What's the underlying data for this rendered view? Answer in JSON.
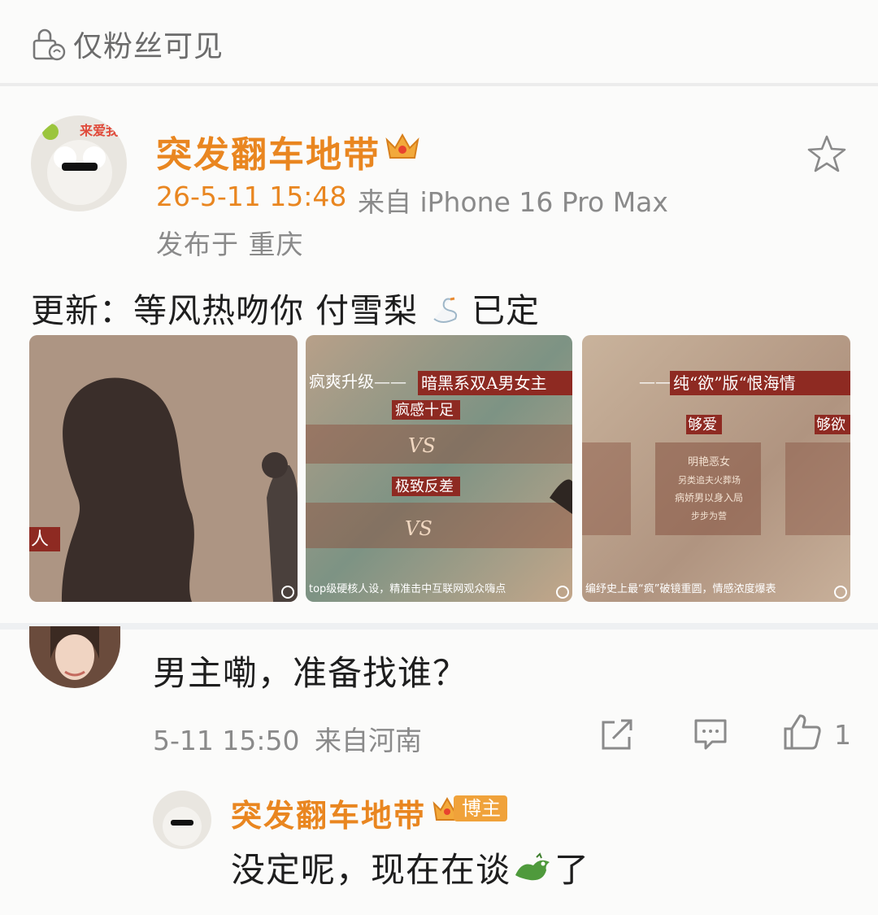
{
  "header": {
    "visibility_label": "仅粉丝可见"
  },
  "post": {
    "username": "突发翻车地带",
    "timestamp": "26-5-11 15:48",
    "source": "来自 iPhone 16 Pro Max",
    "location": "发布于 重庆",
    "content_before": "更新：等风热吻你 付雪梨",
    "content_after": "已定",
    "images": [
      {
        "caption_left": "人"
      },
      {
        "header_left": "疯爽升级——",
        "header_right": "暗黑系双A男女主",
        "tag1": "疯感十足",
        "vs": "VS",
        "tag2": "极致反差",
        "footer": "top级硬核人设，精准击中互联网观众嗨点"
      },
      {
        "header_left": "——",
        "header_right": "纯“欲”版“恨海情",
        "tag1": "够爱",
        "tag2": "够欲",
        "card_lines": [
          "明艳恶女",
          "另类追夫火葬场",
          "病娇男以身入局",
          "步步为营"
        ],
        "footer": "编纾史上最“疯”破镜重圆，情感浓度爆表"
      }
    ]
  },
  "comment": {
    "text": "男主嘞，准备找谁？",
    "timestamp": "5-11 15:50",
    "source": "来自河南",
    "like_count": "1"
  },
  "reply": {
    "username": "突发翻车地带",
    "badge": "博主",
    "text_before": "没定呢，现在在谈",
    "text_after": "了"
  },
  "colors": {
    "accent": "#e98620",
    "meta": "#8a8a8a",
    "badge": "#f0a23a"
  }
}
